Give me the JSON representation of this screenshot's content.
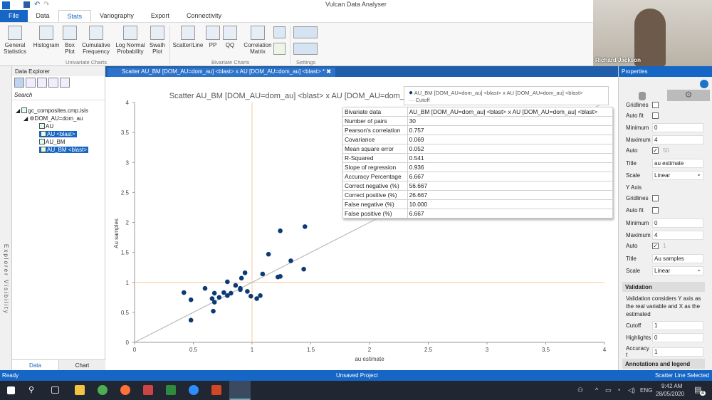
{
  "app": {
    "title": "Vulcan Data Analyser"
  },
  "ribbon": {
    "tabs": [
      "File",
      "Data",
      "Stats",
      "Variography",
      "Export",
      "Connectivity"
    ],
    "active_tab": "Stats",
    "buttons": [
      {
        "label": "General\nStatistics",
        "icon": "table-icon"
      },
      {
        "label": "Histogram",
        "icon": "histogram-icon"
      },
      {
        "label": "Box\nPlot",
        "icon": "boxplot-icon"
      },
      {
        "label": "Cumulative\nFrequency",
        "icon": "cumulative-icon"
      },
      {
        "label": "Log Normal\nProbability",
        "icon": "lognormal-icon"
      },
      {
        "label": "Swath\nPlot",
        "icon": "swath-icon"
      },
      {
        "label": "Scatter/Line",
        "icon": "scatter-icon"
      },
      {
        "label": "PP",
        "icon": "pp-icon"
      },
      {
        "label": "QQ",
        "icon": "qq-icon"
      },
      {
        "label": "Correlation\nMatrix",
        "icon": "matrix-icon"
      }
    ],
    "groups": [
      "Univariate Charts",
      "Bivariate Charts",
      "Settings"
    ]
  },
  "webcam": {
    "name": "Richard Jackson"
  },
  "explorer": {
    "strip_label": "Explorer Visibility",
    "title": "Data Explorer",
    "search_placeholder": "Search",
    "tree": {
      "file": "gc_composites.cmp.isis",
      "domain": "DOM_AU=dom_au",
      "items": [
        "AU",
        "AU <blast>",
        "AU_BM",
        "AU_BM <blast>"
      ]
    },
    "tabs": [
      "Data",
      "Chart"
    ]
  },
  "document": {
    "tab_label": "Scatter AU_BM [DOM_AU=dom_au] <blast> x AU [DOM_AU=dom_au] <blast> *"
  },
  "legend": {
    "series": "AU_BM [DOM_AU=dom_au] <blast> x AU [DOM_AU=dom_au] <blast>",
    "cutoff": "Cutoff"
  },
  "stats": [
    [
      "Bivariate data",
      "AU_BM [DOM_AU=dom_au] <blast> x AU [DOM_AU=dom_au] <blast>"
    ],
    [
      "Number of pairs",
      "30"
    ],
    [
      "Pearson's correlation",
      "0.757"
    ],
    [
      "Covariance",
      "0.069"
    ],
    [
      "Mean square error",
      "0.052"
    ],
    [
      "R-Squared",
      "0.541"
    ],
    [
      "Slope of regression",
      "0.936"
    ],
    [
      "Accuracy Percentage",
      "6.667"
    ],
    [
      "Correct negative (%)",
      "56.667"
    ],
    [
      "Correct positive (%)",
      "26.667"
    ],
    [
      "False negative (%)",
      "10.000"
    ],
    [
      "False positive (%)",
      "6.667"
    ]
  ],
  "chart_data": {
    "type": "scatter",
    "title": "Scatter AU_BM [DOM_AU=dom_au] <blast> x AU [DOM_AU=dom_au] <blast>",
    "xlabel": "au estimate",
    "ylabel": "Au samples",
    "xlim": [
      0,
      4
    ],
    "ylim": [
      0,
      4
    ],
    "xticks": [
      "0",
      "0.5",
      "1",
      "1.5",
      "2",
      "2.5",
      "3",
      "3.5",
      "4"
    ],
    "yticks": [
      "0",
      "0.5",
      "1",
      "1.5",
      "2",
      "2.5",
      "3",
      "3.5",
      "4"
    ],
    "cutoff": 1,
    "reference_line": [
      [
        0,
        0
      ],
      [
        4,
        4
      ]
    ],
    "colors": {
      "points": "#0b3a75",
      "cutoff": "#f5c9a0",
      "line": "#bbbbbb"
    },
    "points": [
      [
        0.42,
        0.83
      ],
      [
        0.48,
        0.71
      ],
      [
        0.48,
        0.37
      ],
      [
        0.6,
        0.9
      ],
      [
        0.67,
        0.52
      ],
      [
        0.66,
        0.73
      ],
      [
        0.68,
        0.67
      ],
      [
        0.68,
        0.82
      ],
      [
        0.72,
        0.75
      ],
      [
        0.76,
        0.83
      ],
      [
        0.79,
        1.01
      ],
      [
        0.79,
        0.78
      ],
      [
        0.82,
        0.82
      ],
      [
        0.86,
        0.95
      ],
      [
        0.9,
        0.88
      ],
      [
        0.9,
        0.9
      ],
      [
        0.91,
        1.07
      ],
      [
        0.94,
        1.16
      ],
      [
        0.96,
        0.85
      ],
      [
        0.99,
        0.77
      ],
      [
        1.04,
        0.73
      ],
      [
        1.07,
        0.78
      ],
      [
        1.09,
        1.14
      ],
      [
        1.14,
        1.47
      ],
      [
        1.22,
        1.09
      ],
      [
        1.24,
        1.1
      ],
      [
        1.24,
        1.86
      ],
      [
        1.33,
        1.36
      ],
      [
        1.44,
        1.22
      ],
      [
        1.45,
        1.93
      ]
    ]
  },
  "properties": {
    "title": "Properties",
    "x_axis": {
      "gridlines_label": "Gridlines",
      "autofit_label": "Auto fit",
      "min_label": "Minimum",
      "min": "0",
      "max_label": "Maximum",
      "max": "4",
      "auto_label": "Auto",
      "auto_value": "50",
      "title_label": "Title",
      "title": "au estimate",
      "scale_label": "Scale",
      "scale": "Linear"
    },
    "y_axis": {
      "header": "Y Axis",
      "gridlines_label": "Gridlines",
      "autofit_label": "Auto fit",
      "min_label": "Minimum",
      "min": "0",
      "max_label": "Maximum",
      "max": "4",
      "auto_label": "Auto",
      "auto_value": "1",
      "title_label": "Title",
      "title": "Au samples",
      "scale_label": "Scale",
      "scale": "Linear"
    },
    "validation": {
      "header": "Validation",
      "desc": "Validation considers Y axis as the real variable and X as the estimated",
      "cutoff_label": "Cutoff",
      "cutoff": "1",
      "highlight_label": "Highlights",
      "highlight": "0",
      "accuracy_label": "Accuracy t",
      "accuracy": "1"
    },
    "annotations_header": "Annotations and legend"
  },
  "status": {
    "left": "Ready",
    "center": "Unsaved Project",
    "right": "Scatter Line Selected"
  },
  "taskbar": {
    "lang": "ENG",
    "time": "9:42 AM",
    "date": "28/05/2020",
    "notifications": "4"
  }
}
